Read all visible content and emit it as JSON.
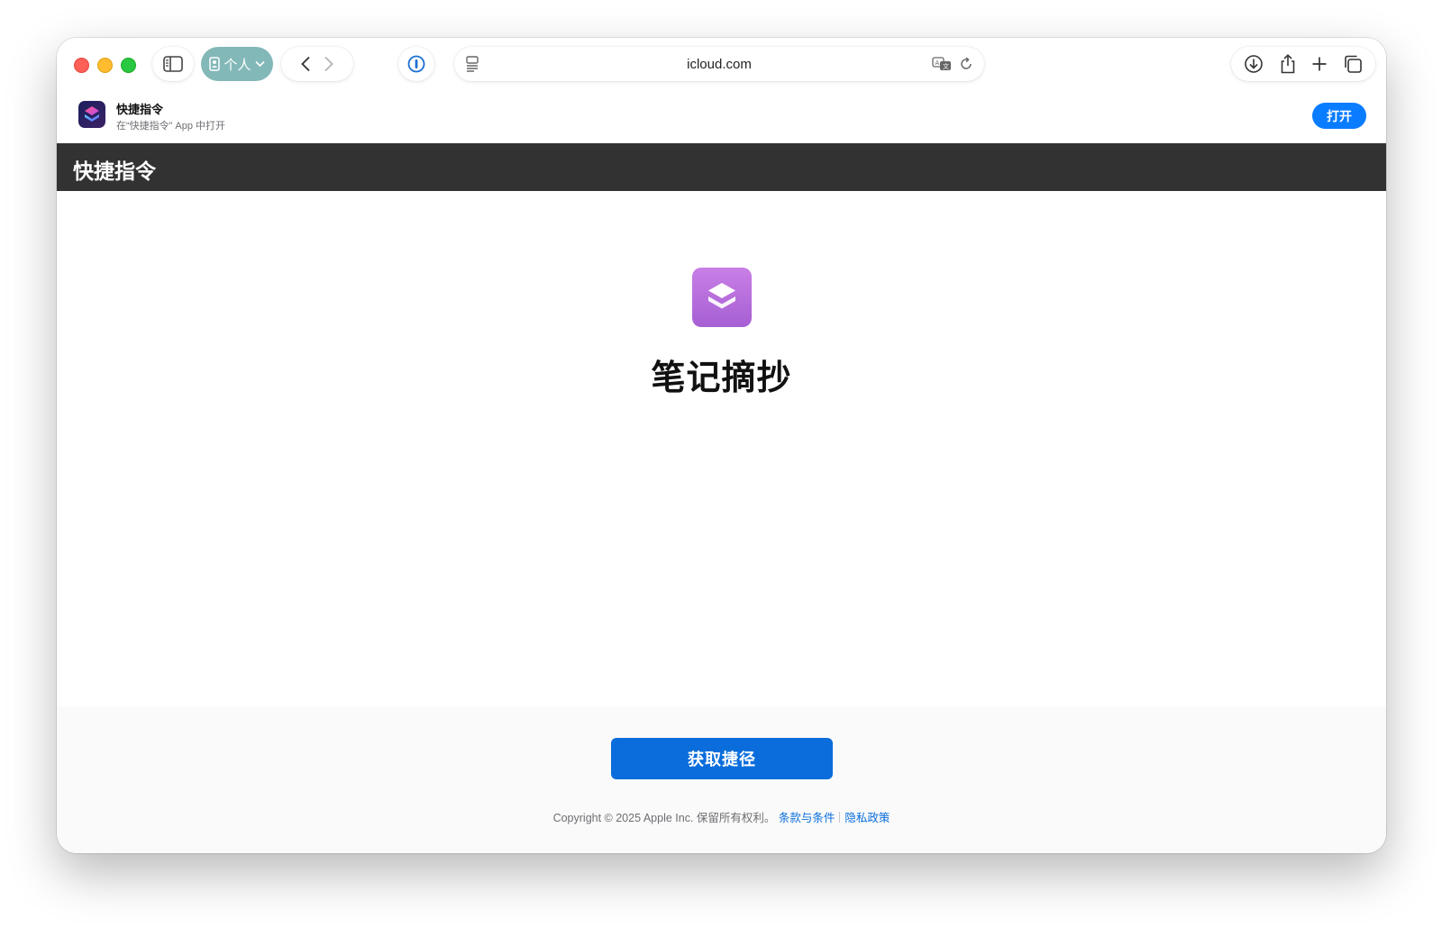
{
  "browser": {
    "profile_label": "个人",
    "address": "icloud.com"
  },
  "banner": {
    "app_name": "快捷指令",
    "subtitle": "在“快捷指令” App 中打开",
    "open_label": "打开"
  },
  "header": {
    "title": "快捷指令"
  },
  "shortcut": {
    "name": "笔记摘抄",
    "icon_color": "#b96fe0"
  },
  "footer": {
    "get_button": "获取捷径",
    "copyright": "Copyright © 2025 Apple Inc. 保留所有权利。",
    "terms_link": "条款与条件",
    "privacy_link": "隐私政策"
  },
  "colors": {
    "accent": "#0a6ddb",
    "header_bg": "#323232",
    "profile_pill": "#83b8b8"
  },
  "icons": [
    "sidebar-icon",
    "person-icon",
    "chevron-down-icon",
    "back-icon",
    "forward-icon",
    "password-icon",
    "reader-icon",
    "translate-icon",
    "reload-icon",
    "download-icon",
    "share-icon",
    "new-tab-icon",
    "tab-overview-icon",
    "shortcuts-app-icon",
    "shortcut-layers-icon"
  ]
}
